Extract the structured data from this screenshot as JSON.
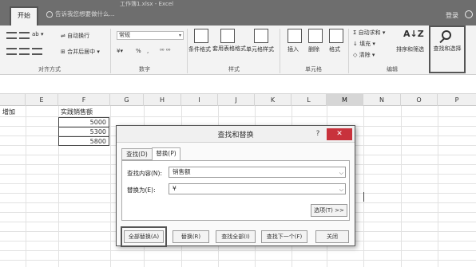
{
  "titlebar": {
    "doc_title": "工作簿1.xlsx - Excel",
    "home_tab": "开始",
    "tell_me": "告诉我您想要做什么...",
    "login": "登录"
  },
  "ribbon": {
    "wrap_text": "自动换行",
    "merge_center": "合并后居中",
    "number_format": "常规",
    "percent": "%",
    "comma": ",",
    "decimals": "⁰⁰ ⁰⁰",
    "conditional_format": "条件格式",
    "format_as_table": "套用表格格式",
    "cell_styles": "单元格样式",
    "insert": "插入",
    "delete": "删除",
    "format": "格式",
    "autosum": "自动求和",
    "fill": "填充",
    "clear": "清除",
    "sort_filter": "排序和筛选",
    "find_select": "查找和选择",
    "groups": {
      "alignment": "对齐方式",
      "number": "数字",
      "styles": "样式",
      "cells": "单元格",
      "editing": "编辑"
    }
  },
  "sheet": {
    "columns": [
      "E",
      "F",
      "G",
      "H",
      "I",
      "J",
      "K",
      "L",
      "M",
      "N",
      "O",
      "P"
    ],
    "active_column": "M",
    "cells": {
      "d2_partial": "增加",
      "f2": "实践销售额",
      "f3": "5000",
      "f4": "5300",
      "f5": "5800"
    }
  },
  "dialog": {
    "title": "查找和替换",
    "help": "?",
    "close": "✕",
    "tabs": {
      "find": "查找(D)",
      "replace": "替换(P)"
    },
    "find_label": "查找内容(N):",
    "find_value": "销售额",
    "replace_label": "替换为(E):",
    "replace_value": "¥",
    "options": "选项(T) >>",
    "buttons": {
      "replace_all": "全部替换(A)",
      "replace": "替换(R)",
      "find_all": "查找全部(I)",
      "find_next": "查找下一个(F)",
      "close": "关闭"
    }
  },
  "colors": {
    "titlebar": "#6e6e6e",
    "ribbon": "#f3f3f3",
    "close_button": "#c8323c"
  }
}
